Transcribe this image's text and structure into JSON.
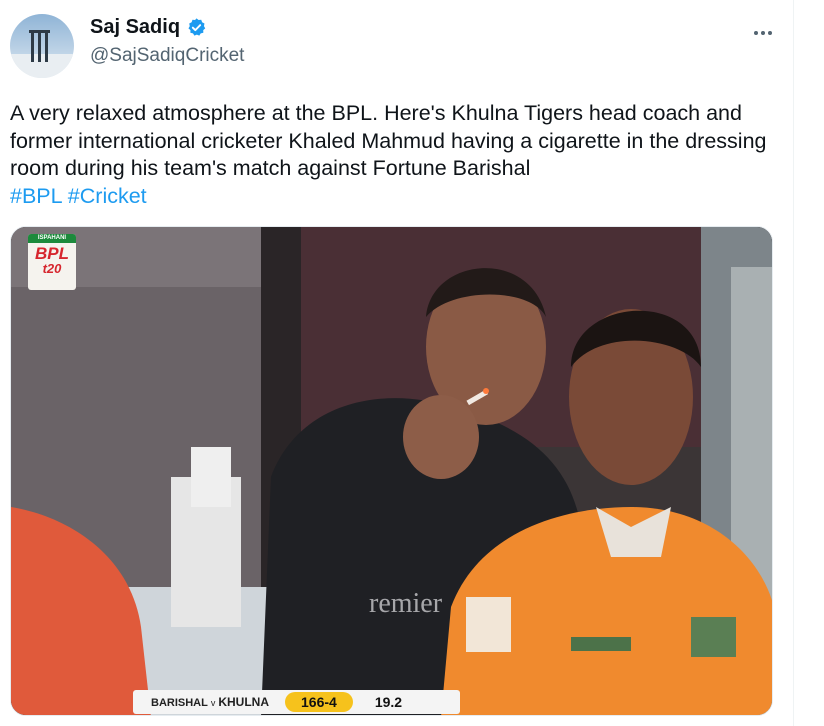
{
  "tweet": {
    "author": {
      "display_name": "Saj Sadiq",
      "handle": "@SajSadiqCricket",
      "verified": true,
      "avatar_icon": "avatar-image"
    },
    "more_icon": "more-options-icon",
    "text": "A very relaxed atmosphere at the BPL. Here's Khulna Tigers head coach and former international cricketer Khaled Mahmud having a cigarette in the dressing room during his team's match against Fortune Barishal ",
    "hashtags": [
      "#BPL",
      "#Cricket"
    ]
  },
  "media": {
    "logo": {
      "brand": "ISPAHANI",
      "title": "BPL",
      "subtitle": "t20"
    },
    "scoreboard": {
      "team1": "BARISHAL",
      "versus": "v",
      "team2": "KHULNA",
      "score": "166-4",
      "overs": "19.2"
    },
    "shirt_text": "remier"
  },
  "colors": {
    "accent": "#1d9bf0",
    "text": "#0f1419",
    "secondary": "#536471",
    "score_badge": "#f6c21c"
  }
}
